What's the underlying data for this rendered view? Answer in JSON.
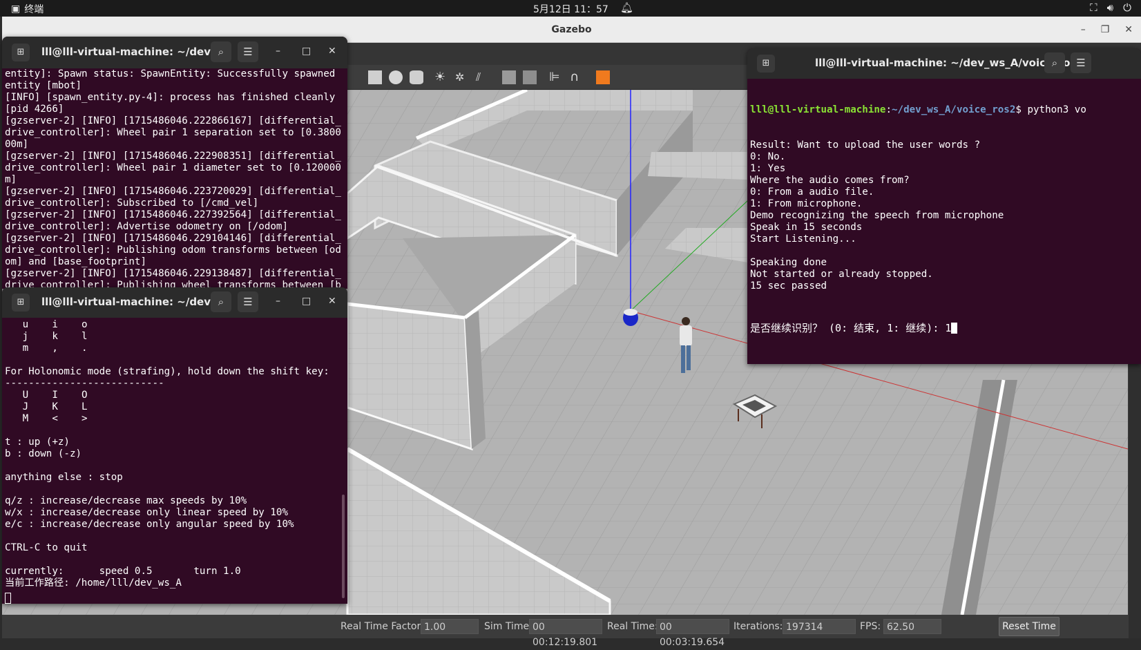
{
  "topbar": {
    "activity": "终端",
    "clock": "5月12日 11：57"
  },
  "gazebo": {
    "title": "Gazebo",
    "bottom": {
      "rtf_label": "Real Time Factor:",
      "rtf_value": "1.00",
      "sim_label": "Sim Time:",
      "sim_value": "00 00:12:19.801",
      "real_label": "Real Time:",
      "real_value": "00 00:03:19.654",
      "iter_label": "Iterations:",
      "iter_value": "197314",
      "fps_label": "FPS:",
      "fps_value": "62.50",
      "reset_label": "Reset Time"
    }
  },
  "term1": {
    "title": "lll@lll-virtual-machine: ~/dev_...",
    "lines": [
      "entity]: Spawn status: SpawnEntity: Successfully spawned",
      "entity [mbot]",
      "[INFO] [spawn_entity.py-4]: process has finished cleanly",
      "[pid 4266]",
      "[gzserver-2] [INFO] [1715486046.222866167] [differential_",
      "drive_controller]: Wheel pair 1 separation set to [0.3800",
      "00m]",
      "[gzserver-2] [INFO] [1715486046.222908351] [differential_",
      "drive_controller]: Wheel pair 1 diameter set to [0.120000",
      "m]",
      "[gzserver-2] [INFO] [1715486046.223720029] [differential_",
      "drive_controller]: Subscribed to [/cmd_vel]",
      "[gzserver-2] [INFO] [1715486046.227392564] [differential_",
      "drive_controller]: Advertise odometry on [/odom]",
      "[gzserver-2] [INFO] [1715486046.229104146] [differential_",
      "drive_controller]: Publishing odom transforms between [od",
      "om] and [base_footprint]",
      "[gzserver-2] [INFO] [1715486046.229138487] [differential_",
      "drive_controller]: Publishing wheel transforms between [b"
    ]
  },
  "term2": {
    "title": "lll@lll-virtual-machine: ~/dev_...",
    "lines": [
      "   u    i    o",
      "   j    k    l",
      "   m    ,    .",
      "",
      "For Holonomic mode (strafing), hold down the shift key:",
      "---------------------------",
      "   U    I    O",
      "   J    K    L",
      "   M    <    >",
      "",
      "t : up (+z)",
      "b : down (-z)",
      "",
      "anything else : stop",
      "",
      "q/z : increase/decrease max speeds by 10%",
      "w/x : increase/decrease only linear speed by 10%",
      "e/c : increase/decrease only angular speed by 10%",
      "",
      "CTRL-C to quit",
      "",
      "currently:      speed 0.5       turn 1.0",
      "当前工作路径: /home/lll/dev_ws_A"
    ]
  },
  "term3": {
    "title": "lll@lll-virtual-machine: ~/dev_ws_A/voice_ros2",
    "prompt_user": "lll@lll-virtual-machine",
    "prompt_sep": ":",
    "prompt_path": "~/dev_ws_A/voice_ros2",
    "prompt_cmd": "$ python3 vo",
    "lines": [
      "Result: Want to upload the user words ?",
      "0: No.",
      "1: Yes",
      "Where the audio comes from?",
      "0: From a audio file.",
      "1: From microphone.",
      "Demo recognizing the speech from microphone",
      "Speak in 15 seconds",
      "Start Listening...",
      "",
      "Speaking done",
      "Not started or already stopped.",
      "15 sec passed"
    ],
    "question": "是否继续识别？ (0: 结束, 1: 继续): 1"
  }
}
